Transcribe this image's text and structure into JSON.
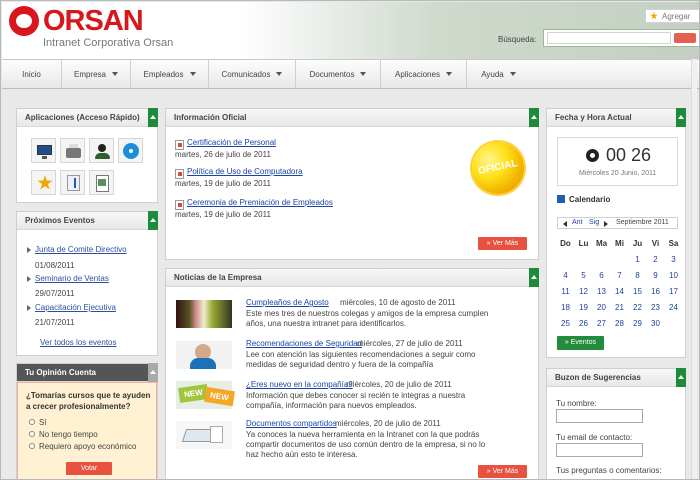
{
  "header": {
    "logo_text": "ORSAN",
    "subtitle": "Intranet Corporativa Orsan",
    "favorite_label": "Agregar",
    "search_label": "Búsqueda:"
  },
  "nav": [
    "Inicio",
    "Empresa",
    "Empleados",
    "Comunicados",
    "Documentos",
    "Aplicaciones",
    "Ayuda"
  ],
  "apps": {
    "title": "Aplicaciones (Acceso Rápido)",
    "icons": [
      "monitor-icon",
      "shredder-icon",
      "user-icon",
      "disc-icon",
      "star-icon",
      "music-icon",
      "document-icon"
    ]
  },
  "events": {
    "title": "Próximos Eventos",
    "items": [
      {
        "title": "Junta de Comite Directivo",
        "date": "01/08/2011"
      },
      {
        "title": "Seminario de Ventas",
        "date": "29/07/2011"
      },
      {
        "title": "Capacitación Ejecutiva",
        "date": "21/07/2011"
      }
    ],
    "all_link": "Ver todos los eventos"
  },
  "poll": {
    "title": "Tu Opinión Cuenta",
    "question": "¿Tomarías cursos que te ayuden a crecer profesionalmente?",
    "options": [
      "Sí",
      "No tengo tiempo",
      "Requiero apoyo económico"
    ],
    "vote": "Votar"
  },
  "official": {
    "title": "Información Oficial",
    "badge": "OFICIAL",
    "items": [
      {
        "title": "Certificación de Personal",
        "date": "martes, 26 de julio de 2011"
      },
      {
        "title": "Política de Uso de Computadora",
        "date": "martes, 19 de julio de 2011"
      },
      {
        "title": "Ceremonia de Premiación de Empleados",
        "date": "martes, 19 de julio de 2011"
      }
    ],
    "more": "» Ver Más"
  },
  "news": {
    "title": "Noticias de la Empresa",
    "items": [
      {
        "title": "Cumpleaños de Agosto",
        "date": "miércoles, 10 de agosto de 2011",
        "desc": "Este mes tres de nuestros colegas y amigos de la empresa cumplen años, una nuestra intranet para identificarlos."
      },
      {
        "title": "Recomendaciones de Seguridad",
        "date": "miércoles, 27 de julio de 2011",
        "desc": "Lee con atención las siguientes recomendaciones a seguir como medidas de seguridad dentro y fuera de la compañía"
      },
      {
        "title": "¿Eres nuevo en la compañía?",
        "date": "miércoles, 20 de julio de 2011",
        "desc": "Información que debes conocer si recién te integras a nuestra compañía, información para nuevos empleados."
      },
      {
        "title": "Documentos compartidos",
        "date": "miércoles, 20 de julio de 2011",
        "desc": "Ya conoces la nueva herramienta en la Intranet con la que podrás compartir documentos de uso común dentro de la empresa, si no lo haz hecho aún esto te interesa."
      }
    ],
    "new_badge": "NEW",
    "more": "» Ver Más"
  },
  "datetime": {
    "title": "Fecha y Hora Actual",
    "time": "00 26",
    "date": "Miércoles 20 Junio, 2011"
  },
  "calendar": {
    "title": "Calendario",
    "ant": "Ant",
    "sig": "Sig",
    "month": "Septiembre 2011",
    "headers": [
      "Do",
      "Lu",
      "Ma",
      "Mi",
      "Ju",
      "Vi",
      "Sa"
    ],
    "weeks": [
      [
        "",
        "",
        "",
        "",
        "1",
        "2",
        "3"
      ],
      [
        "4",
        "5",
        "6",
        "7",
        "8",
        "9",
        "10"
      ],
      [
        "11",
        "12",
        "13",
        "14",
        "15",
        "16",
        "17"
      ],
      [
        "18",
        "19",
        "20",
        "21",
        "22",
        "23",
        "24"
      ],
      [
        "25",
        "26",
        "27",
        "28",
        "29",
        "30",
        ""
      ]
    ],
    "events_button": "» Eventos"
  },
  "suggestions": {
    "title": "Buzon de Sugerencias",
    "name_label": "Tu nombre:",
    "email_label": "Tu email de contacto:",
    "comments_label": "Tus preguntas o comentarios:"
  },
  "colors": {
    "brand": "#d8161c",
    "accent_green": "#228c3c",
    "link": "#1b43a8"
  }
}
